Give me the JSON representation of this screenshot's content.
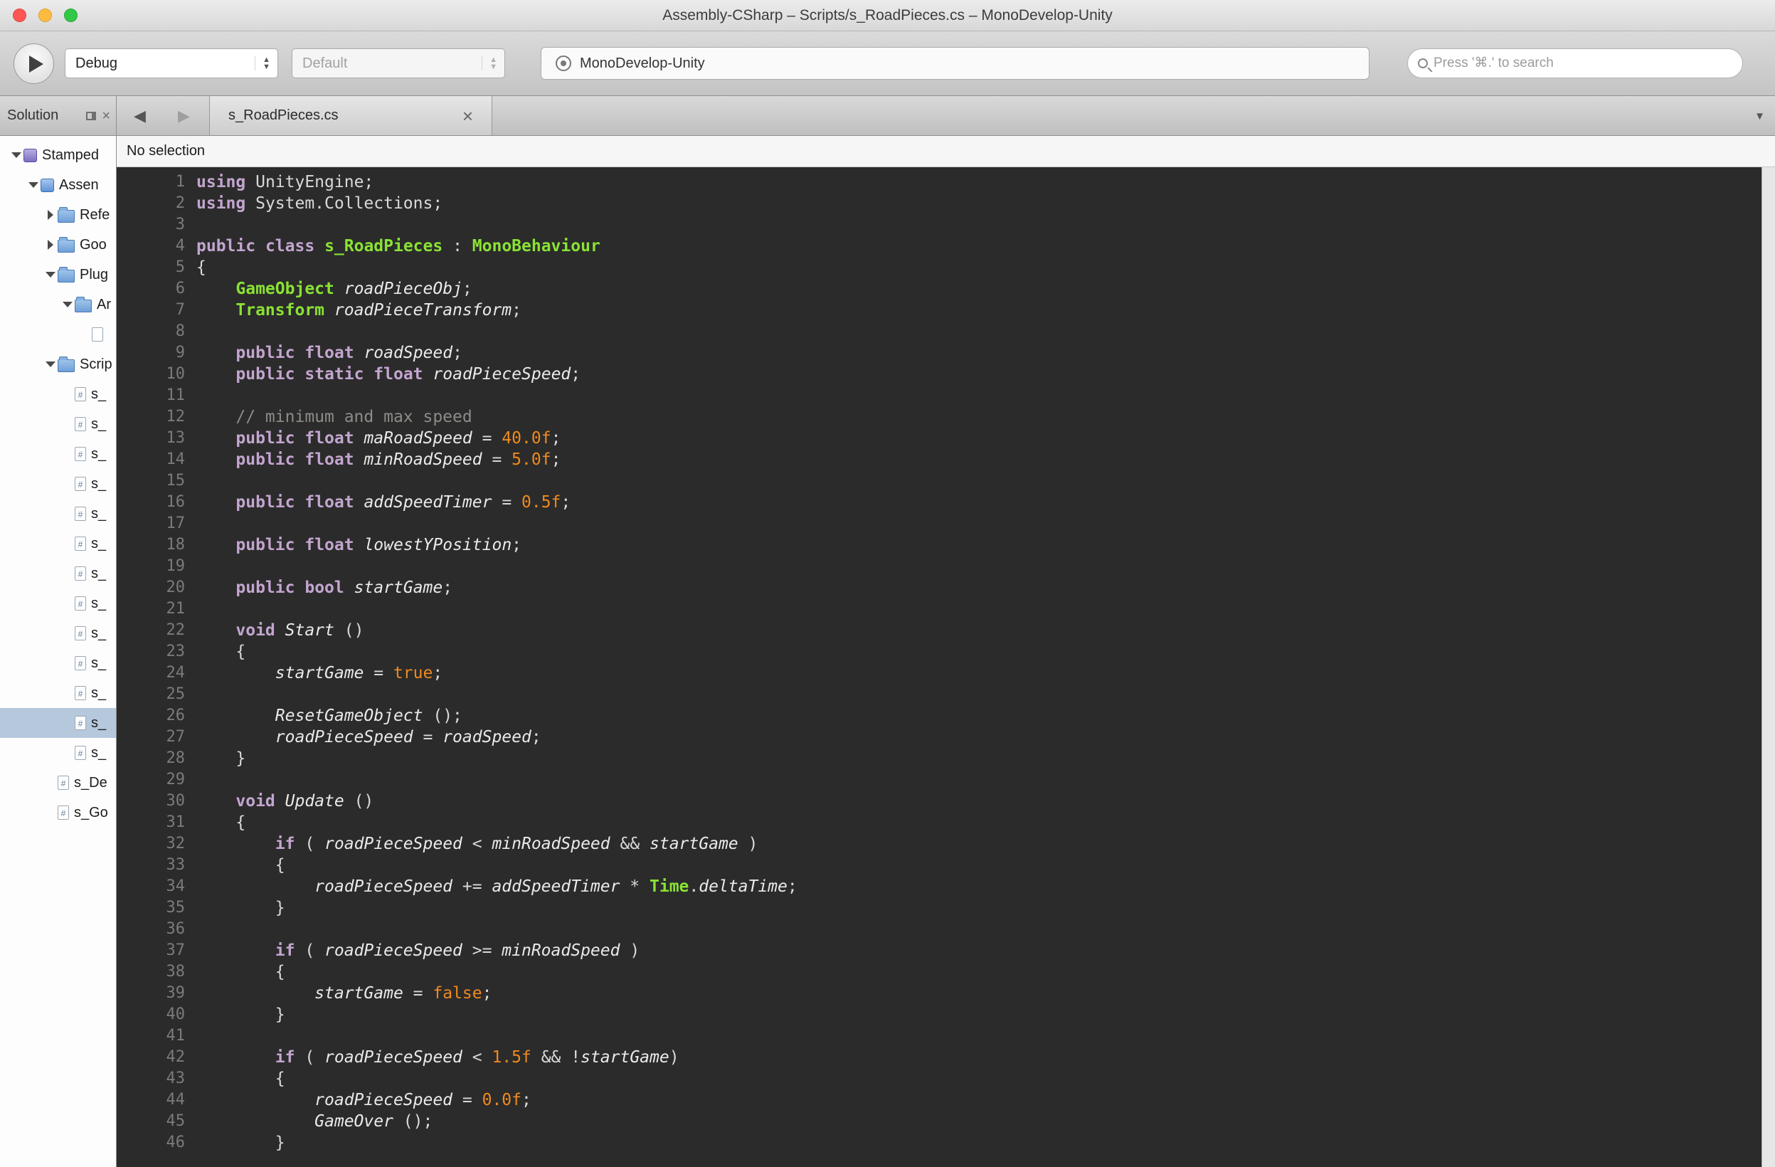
{
  "window": {
    "title": "Assembly-CSharp – Scripts/s_RoadPieces.cs – MonoDevelop-Unity"
  },
  "toolbar": {
    "configuration": "Debug",
    "device": "Default",
    "status_text": "MonoDevelop-Unity",
    "search_placeholder": "Press '⌘.' to search"
  },
  "glyphs": {
    "stepper_up": "▲",
    "stepper_down": "▼",
    "back": "◀",
    "forward": "▶",
    "close_tab": "×",
    "close_panel": "×",
    "tab_list": "▼"
  },
  "sidebar": {
    "title": "Solution",
    "tree": [
      {
        "indent": 0,
        "arrow": "down",
        "icon": "solution",
        "label": "Stamped"
      },
      {
        "indent": 1,
        "arrow": "down",
        "icon": "project",
        "label": "Assen"
      },
      {
        "indent": 2,
        "arrow": "right",
        "icon": "folder",
        "label": "Refe"
      },
      {
        "indent": 2,
        "arrow": "right",
        "icon": "folder",
        "label": "Goo"
      },
      {
        "indent": 2,
        "arrow": "down",
        "icon": "folder",
        "label": "Plug"
      },
      {
        "indent": 3,
        "arrow": "down",
        "icon": "folder",
        "label": "Ar"
      },
      {
        "indent": 4,
        "arrow": "none",
        "icon": "file",
        "label": ""
      },
      {
        "indent": 2,
        "arrow": "down",
        "icon": "folder",
        "label": "Scrip"
      },
      {
        "indent": 3,
        "arrow": "none",
        "icon": "csfile",
        "label": "s_"
      },
      {
        "indent": 3,
        "arrow": "none",
        "icon": "csfile",
        "label": "s_"
      },
      {
        "indent": 3,
        "arrow": "none",
        "icon": "csfile",
        "label": "s_"
      },
      {
        "indent": 3,
        "arrow": "none",
        "icon": "csfile",
        "label": "s_"
      },
      {
        "indent": 3,
        "arrow": "none",
        "icon": "csfile",
        "label": "s_"
      },
      {
        "indent": 3,
        "arrow": "none",
        "icon": "csfile",
        "label": "s_"
      },
      {
        "indent": 3,
        "arrow": "none",
        "icon": "csfile",
        "label": "s_"
      },
      {
        "indent": 3,
        "arrow": "none",
        "icon": "csfile",
        "label": "s_"
      },
      {
        "indent": 3,
        "arrow": "none",
        "icon": "csfile",
        "label": "s_"
      },
      {
        "indent": 3,
        "arrow": "none",
        "icon": "csfile",
        "label": "s_"
      },
      {
        "indent": 3,
        "arrow": "none",
        "icon": "csfile",
        "label": "s_"
      },
      {
        "indent": 3,
        "arrow": "none",
        "icon": "csfile",
        "label": "s_",
        "selected": true
      },
      {
        "indent": 3,
        "arrow": "none",
        "icon": "csfile",
        "label": "s_"
      },
      {
        "indent": 2,
        "arrow": "none",
        "icon": "csfile",
        "label": "s_De"
      },
      {
        "indent": 2,
        "arrow": "none",
        "icon": "csfile",
        "label": "s_Go"
      }
    ]
  },
  "tabbar": {
    "tab_label": "s_RoadPieces.cs"
  },
  "breadcrumb": {
    "text": "No selection"
  },
  "theme": {
    "editor-bg": "#2b2b2b",
    "code-plain": "#d9d9d9",
    "code-kw": "#c3a5cf",
    "code-type": "#8ae234",
    "code-ident": "#eaeaea",
    "code-num": "#ef8a1e",
    "code-comment": "#8b8d87",
    "code-linenum": "#7b7b7b",
    "tree-selection": "#b5c8dc"
  },
  "editor": {
    "first_line": 1,
    "lines": [
      [
        [
          "k",
          "using"
        ],
        [
          "p",
          " UnityEngine;"
        ]
      ],
      [
        [
          "k",
          "using"
        ],
        [
          "p",
          " System.Collections;"
        ]
      ],
      [],
      [
        [
          "k",
          "public"
        ],
        [
          "p",
          " "
        ],
        [
          "k",
          "class"
        ],
        [
          "p",
          " "
        ],
        [
          "t",
          "s_RoadPieces"
        ],
        [
          "p",
          " : "
        ],
        [
          "t",
          "MonoBehaviour"
        ]
      ],
      [
        [
          "p",
          "{"
        ]
      ],
      [
        [
          "p",
          "    "
        ],
        [
          "t",
          "GameObject"
        ],
        [
          "p",
          " "
        ],
        [
          "i",
          "roadPieceObj"
        ],
        [
          "p",
          ";"
        ]
      ],
      [
        [
          "p",
          "    "
        ],
        [
          "t",
          "Transform"
        ],
        [
          "p",
          " "
        ],
        [
          "i",
          "roadPieceTransform"
        ],
        [
          "p",
          ";"
        ]
      ],
      [],
      [
        [
          "p",
          "    "
        ],
        [
          "k",
          "public"
        ],
        [
          "p",
          " "
        ],
        [
          "k",
          "float"
        ],
        [
          "p",
          " "
        ],
        [
          "i",
          "roadSpeed"
        ],
        [
          "p",
          ";"
        ]
      ],
      [
        [
          "p",
          "    "
        ],
        [
          "k",
          "public"
        ],
        [
          "p",
          " "
        ],
        [
          "k",
          "static"
        ],
        [
          "p",
          " "
        ],
        [
          "k",
          "float"
        ],
        [
          "p",
          " "
        ],
        [
          "i",
          "roadPieceSpeed"
        ],
        [
          "p",
          ";"
        ]
      ],
      [],
      [
        [
          "p",
          "    "
        ],
        [
          "c",
          "// minimum and max speed"
        ]
      ],
      [
        [
          "p",
          "    "
        ],
        [
          "k",
          "public"
        ],
        [
          "p",
          " "
        ],
        [
          "k",
          "float"
        ],
        [
          "p",
          " "
        ],
        [
          "i",
          "maRoadSpeed"
        ],
        [
          "p",
          " = "
        ],
        [
          "n",
          "40.0f"
        ],
        [
          "p",
          ";"
        ]
      ],
      [
        [
          "p",
          "    "
        ],
        [
          "k",
          "public"
        ],
        [
          "p",
          " "
        ],
        [
          "k",
          "float"
        ],
        [
          "p",
          " "
        ],
        [
          "i",
          "minRoadSpeed"
        ],
        [
          "p",
          " = "
        ],
        [
          "n",
          "5.0f"
        ],
        [
          "p",
          ";"
        ]
      ],
      [],
      [
        [
          "p",
          "    "
        ],
        [
          "k",
          "public"
        ],
        [
          "p",
          " "
        ],
        [
          "k",
          "float"
        ],
        [
          "p",
          " "
        ],
        [
          "i",
          "addSpeedTimer"
        ],
        [
          "p",
          " = "
        ],
        [
          "n",
          "0.5f"
        ],
        [
          "p",
          ";"
        ]
      ],
      [],
      [
        [
          "p",
          "    "
        ],
        [
          "k",
          "public"
        ],
        [
          "p",
          " "
        ],
        [
          "k",
          "float"
        ],
        [
          "p",
          " "
        ],
        [
          "i",
          "lowestYPosition"
        ],
        [
          "p",
          ";"
        ]
      ],
      [],
      [
        [
          "p",
          "    "
        ],
        [
          "k",
          "public"
        ],
        [
          "p",
          " "
        ],
        [
          "k",
          "bool"
        ],
        [
          "p",
          " "
        ],
        [
          "i",
          "startGame"
        ],
        [
          "p",
          ";"
        ]
      ],
      [],
      [
        [
          "p",
          "    "
        ],
        [
          "k",
          "void"
        ],
        [
          "p",
          " "
        ],
        [
          "i",
          "Start"
        ],
        [
          "p",
          " ()"
        ]
      ],
      [
        [
          "p",
          "    {"
        ]
      ],
      [
        [
          "p",
          "        "
        ],
        [
          "i",
          "startGame"
        ],
        [
          "p",
          " = "
        ],
        [
          "n",
          "true"
        ],
        [
          "p",
          ";"
        ]
      ],
      [],
      [
        [
          "p",
          "        "
        ],
        [
          "i",
          "ResetGameObject"
        ],
        [
          "p",
          " ();"
        ]
      ],
      [
        [
          "p",
          "        "
        ],
        [
          "i",
          "roadPieceSpeed"
        ],
        [
          "p",
          " = "
        ],
        [
          "i",
          "roadSpeed"
        ],
        [
          "p",
          ";"
        ]
      ],
      [
        [
          "p",
          "    }"
        ]
      ],
      [],
      [
        [
          "p",
          "    "
        ],
        [
          "k",
          "void"
        ],
        [
          "p",
          " "
        ],
        [
          "i",
          "Update"
        ],
        [
          "p",
          " ()"
        ]
      ],
      [
        [
          "p",
          "    {"
        ]
      ],
      [
        [
          "p",
          "        "
        ],
        [
          "k",
          "if"
        ],
        [
          "p",
          " ( "
        ],
        [
          "i",
          "roadPieceSpeed"
        ],
        [
          "p",
          " < "
        ],
        [
          "i",
          "minRoadSpeed"
        ],
        [
          "p",
          " && "
        ],
        [
          "i",
          "startGame"
        ],
        [
          "p",
          " )"
        ]
      ],
      [
        [
          "p",
          "        {"
        ]
      ],
      [
        [
          "p",
          "            "
        ],
        [
          "i",
          "roadPieceSpeed"
        ],
        [
          "p",
          " += "
        ],
        [
          "i",
          "addSpeedTimer"
        ],
        [
          "p",
          " * "
        ],
        [
          "t",
          "Time"
        ],
        [
          "p",
          "."
        ],
        [
          "i",
          "deltaTime"
        ],
        [
          "p",
          ";"
        ]
      ],
      [
        [
          "p",
          "        }"
        ]
      ],
      [],
      [
        [
          "p",
          "        "
        ],
        [
          "k",
          "if"
        ],
        [
          "p",
          " ( "
        ],
        [
          "i",
          "roadPieceSpeed"
        ],
        [
          "p",
          " >= "
        ],
        [
          "i",
          "minRoadSpeed"
        ],
        [
          "p",
          " )"
        ]
      ],
      [
        [
          "p",
          "        {"
        ]
      ],
      [
        [
          "p",
          "            "
        ],
        [
          "i",
          "startGame"
        ],
        [
          "p",
          " = "
        ],
        [
          "n",
          "false"
        ],
        [
          "p",
          ";"
        ]
      ],
      [
        [
          "p",
          "        }"
        ]
      ],
      [],
      [
        [
          "p",
          "        "
        ],
        [
          "k",
          "if"
        ],
        [
          "p",
          " ( "
        ],
        [
          "i",
          "roadPieceSpeed"
        ],
        [
          "p",
          " < "
        ],
        [
          "n",
          "1.5f"
        ],
        [
          "p",
          " && !"
        ],
        [
          "i",
          "startGame"
        ],
        [
          "p",
          ")"
        ]
      ],
      [
        [
          "p",
          "        {"
        ]
      ],
      [
        [
          "p",
          "            "
        ],
        [
          "i",
          "roadPieceSpeed"
        ],
        [
          "p",
          " = "
        ],
        [
          "n",
          "0.0f"
        ],
        [
          "p",
          ";"
        ]
      ],
      [
        [
          "p",
          "            "
        ],
        [
          "i",
          "GameOver"
        ],
        [
          "p",
          " ();"
        ]
      ],
      [
        [
          "p",
          "        }"
        ]
      ]
    ]
  }
}
